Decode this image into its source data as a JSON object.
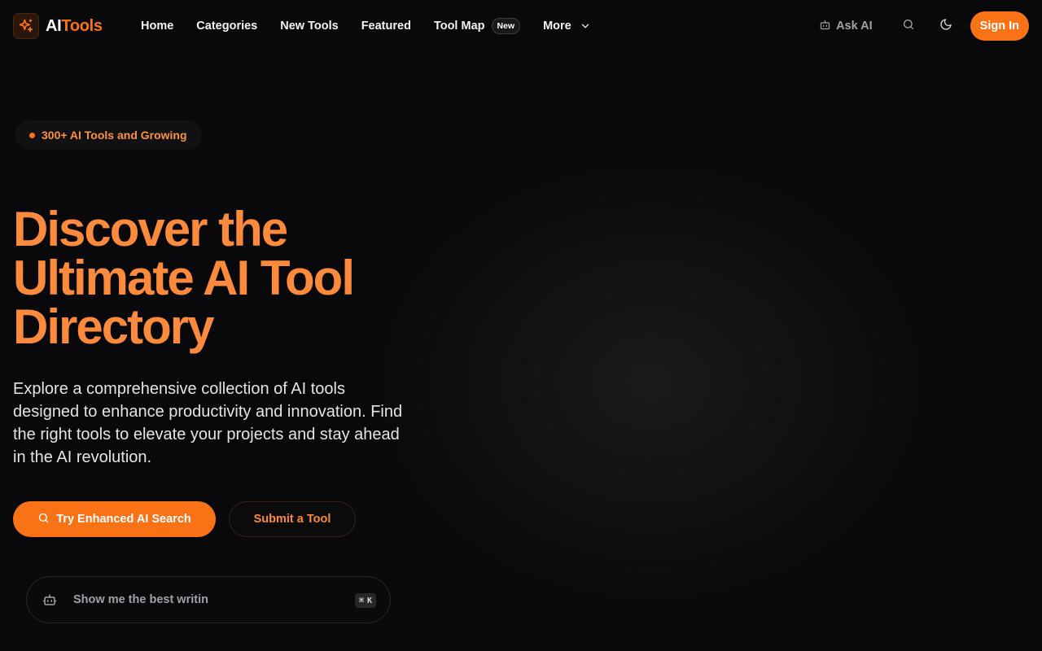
{
  "brand": {
    "name_part1": "AI",
    "name_part2": "Tools",
    "accent": "#f97316",
    "logo_icon": "sparkle-icon"
  },
  "nav": {
    "items": [
      {
        "label": "Home"
      },
      {
        "label": "Categories"
      },
      {
        "label": "New Tools"
      },
      {
        "label": "Featured"
      },
      {
        "label": "Tool Map",
        "badge": "New"
      },
      {
        "label": "More",
        "icon": "chevron-down-icon"
      }
    ],
    "ask_ai": "Ask AI",
    "ask_ai_icon": "robot-icon",
    "search_icon": "search-icon",
    "theme_icon": "moon-icon",
    "sign_in": "Sign In"
  },
  "hero": {
    "pill": "300+ AI Tools and Growing",
    "headline_line1": "Discover the",
    "headline_line2": "Ultimate AI Tool",
    "headline_line3": "Directory",
    "subtext": "Explore a comprehensive collection of AI tools designed to enhance productivity and innovation. Find the right tools to elevate your projects and stay ahead in the AI revolution.",
    "primary_button": "Try Enhanced AI Search",
    "secondary_button": "Submit a Tool"
  },
  "ai_search": {
    "value": "Show me the best writin",
    "shortcut_symbol": "⌘",
    "shortcut_key": "K"
  }
}
